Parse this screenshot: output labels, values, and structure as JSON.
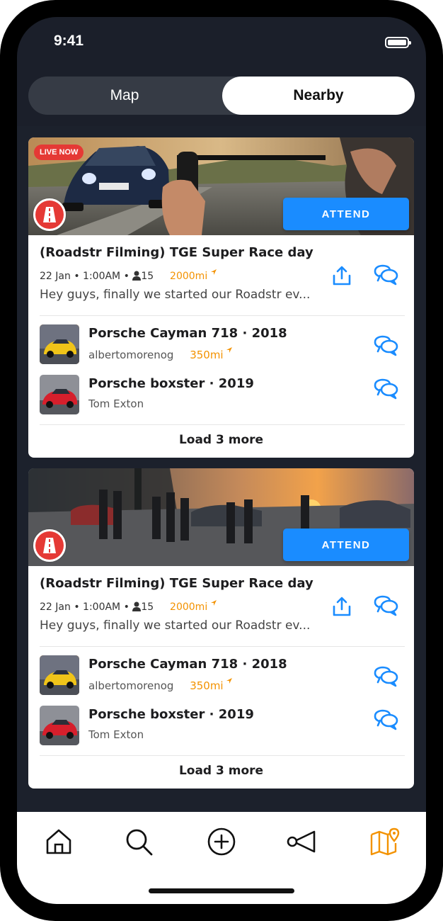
{
  "status": {
    "time": "9:41"
  },
  "segmented": {
    "map": "Map",
    "nearby": "Nearby"
  },
  "colors": {
    "accent": "#1a8cff",
    "distance": "#f39200",
    "live": "#e53935"
  },
  "events": [
    {
      "live_badge": "LIVE NOW",
      "attend_label": "ATTEND",
      "title": "(Roadstr Filming) TGE Super Race day",
      "date": "22 Jan",
      "time": "1:00AM",
      "attendees": "15",
      "distance": "2000mi",
      "description": "Hey guys, finally we started our Roadstr ev...",
      "cars": [
        {
          "name": "Porsche Cayman 718",
          "year": "2018",
          "owner": "albertomorenog",
          "distance": "350mi"
        },
        {
          "name": "Porsche boxster",
          "year": "2019",
          "owner": "Tom Exton",
          "distance": ""
        }
      ],
      "load_more": "Load 3 more"
    },
    {
      "live_badge": "",
      "attend_label": "ATTEND",
      "title": "(Roadstr Filming) TGE Super Race day",
      "date": "22 Jan",
      "time": "1:00AM",
      "attendees": "15",
      "distance": "2000mi",
      "description": "Hey guys, finally we started our Roadstr ev...",
      "cars": [
        {
          "name": "Porsche Cayman 718",
          "year": "2018",
          "owner": "albertomorenog",
          "distance": "350mi"
        },
        {
          "name": "Porsche boxster",
          "year": "2019",
          "owner": "Tom Exton",
          "distance": ""
        }
      ],
      "load_more": "Load 3 more"
    }
  ],
  "tabs": [
    {
      "icon": "home-icon"
    },
    {
      "icon": "search-icon"
    },
    {
      "icon": "add-icon"
    },
    {
      "icon": "megaphone-icon"
    },
    {
      "icon": "map-icon",
      "active": true
    }
  ]
}
